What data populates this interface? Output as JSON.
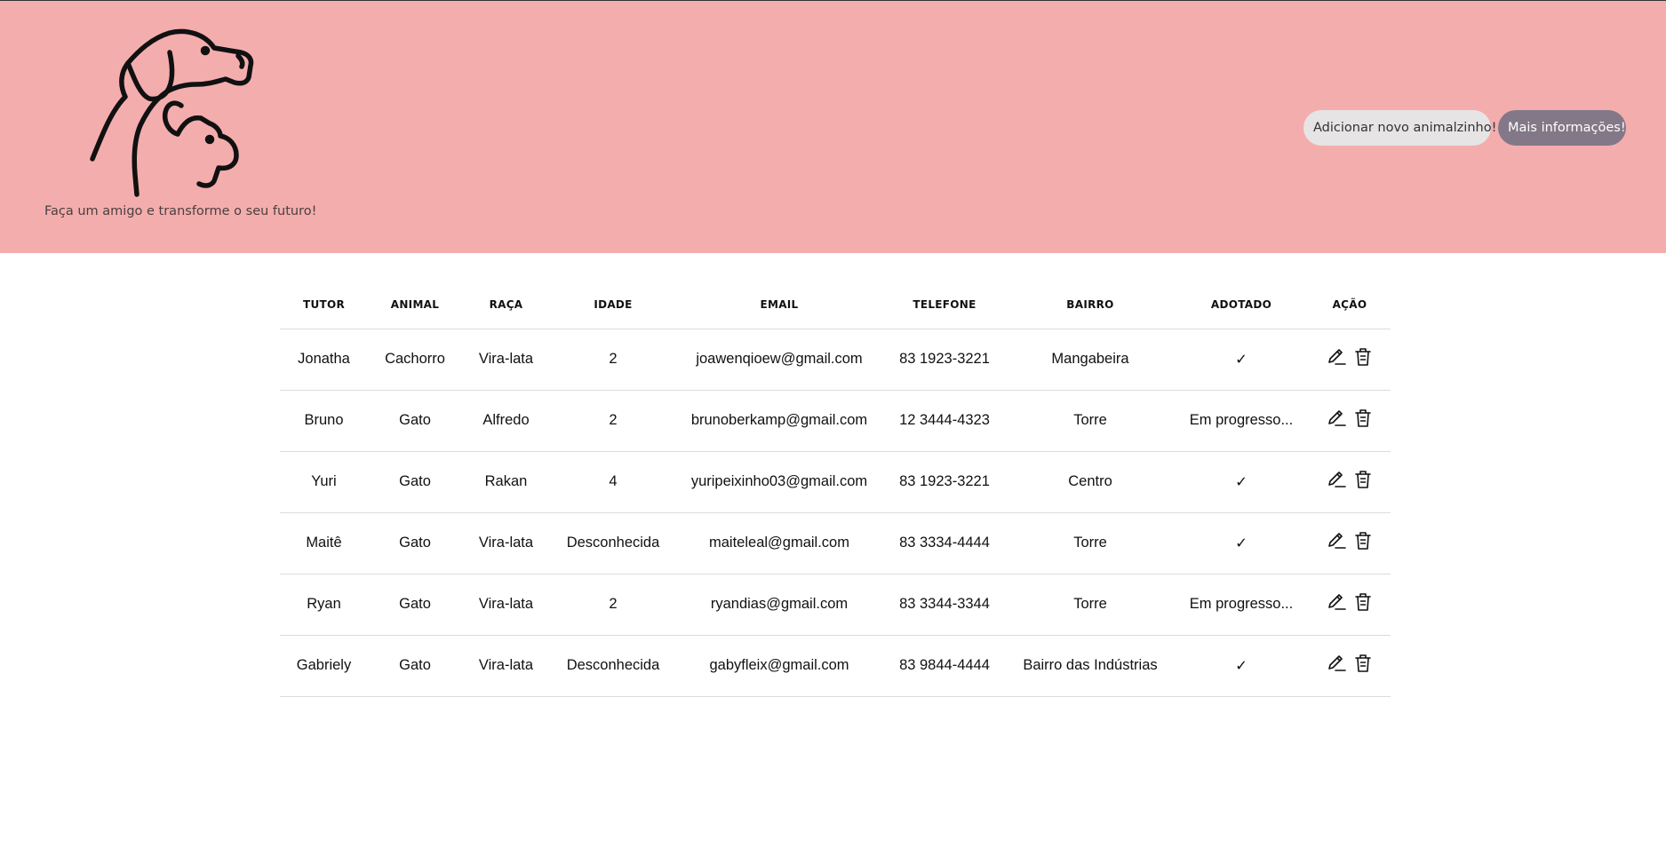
{
  "header": {
    "tagline": "Faça um amigo e transforme o seu futuro!",
    "logo_icon": "dog-cat-logo-icon",
    "add_button_label": "Adicionar novo animalzinho!",
    "info_button_label": "Mais informações!",
    "background_color": "#f4adad",
    "info_button_color": "#837887",
    "add_button_color": "#e6e4e4"
  },
  "table": {
    "columns": [
      "TUTOR",
      "ANIMAL",
      "RAÇA",
      "IDADE",
      "EMAIL",
      "TELEFONE",
      "BAIRRO",
      "ADOTADO",
      "AÇÃO"
    ],
    "rows": [
      {
        "tutor": "Jonatha",
        "animal": "Cachorro",
        "raca": "Vira-lata",
        "idade": "2",
        "email": "joawenqioew@gmail.com",
        "telefone": "83 1923-3221",
        "bairro": "Mangabeira",
        "adotado": "✓"
      },
      {
        "tutor": "Bruno",
        "animal": "Gato",
        "raca": "Alfredo",
        "idade": "2",
        "email": "brunoberkamp@gmail.com",
        "telefone": "12 3444-4323",
        "bairro": "Torre",
        "adotado": "Em progresso..."
      },
      {
        "tutor": "Yuri",
        "animal": "Gato",
        "raca": "Rakan",
        "idade": "4",
        "email": "yuripeixinho03@gmail.com",
        "telefone": "83 1923-3221",
        "bairro": "Centro",
        "adotado": "✓"
      },
      {
        "tutor": "Maitê",
        "animal": "Gato",
        "raca": "Vira-lata",
        "idade": "Desconhecida",
        "email": "maiteleal@gmail.com",
        "telefone": "83 3334-4444",
        "bairro": "Torre",
        "adotado": "✓"
      },
      {
        "tutor": "Ryan",
        "animal": "Gato",
        "raca": "Vira-lata",
        "idade": "2",
        "email": "ryandias@gmail.com",
        "telefone": "83 3344-3344",
        "bairro": "Torre",
        "adotado": "Em progresso..."
      },
      {
        "tutor": "Gabriely",
        "animal": "Gato",
        "raca": "Vira-lata",
        "idade": "Desconhecida",
        "email": "gabyfleix@gmail.com",
        "telefone": "83 9844-4444",
        "bairro": "Bairro das Indústrias",
        "adotado": "✓"
      }
    ],
    "action_icons": [
      "edit-icon",
      "trash-icon"
    ]
  }
}
